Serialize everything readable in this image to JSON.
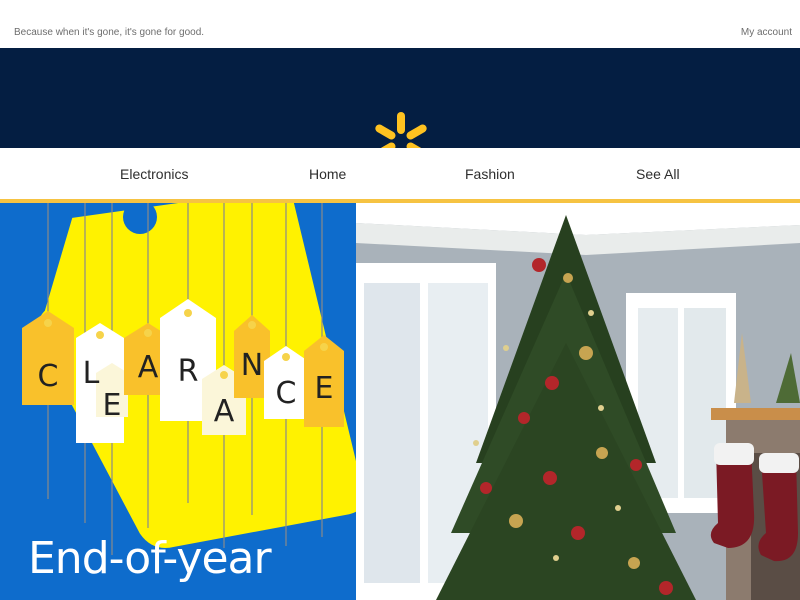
{
  "topbar": {
    "tagline": "Because when it's gone, it's gone for good.",
    "account_link": "My account"
  },
  "header": {
    "logo_icon": "walmart-spark-icon",
    "brand_color": "#041e42",
    "spark_color": "#ffc220"
  },
  "nav": {
    "items": [
      {
        "label": "Electronics"
      },
      {
        "label": "Home"
      },
      {
        "label": "Fashion"
      },
      {
        "label": "See All"
      }
    ],
    "rule_color": "#f6c342"
  },
  "hero": {
    "promo": {
      "letters": [
        "C",
        "L",
        "E",
        "A",
        "R",
        "A",
        "N",
        "C",
        "E"
      ],
      "title": "End-of-year",
      "background": "#0e6ccc"
    }
  }
}
